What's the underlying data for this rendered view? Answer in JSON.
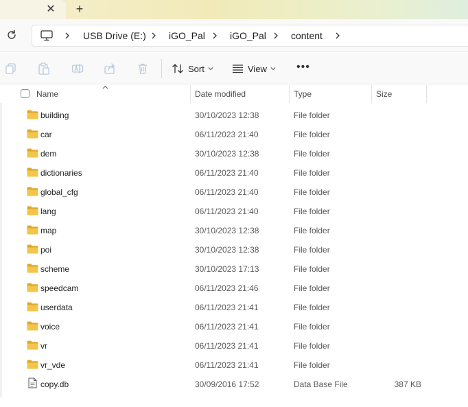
{
  "tabs": {
    "close_symbol": "✕",
    "new_tab_symbol": "+"
  },
  "address": {
    "breadcrumbs": [
      "USB Drive (E:)",
      "iGO_Pal",
      "iGO_Pal",
      "content"
    ]
  },
  "toolbar": {
    "sort_label": "Sort",
    "view_label": "View",
    "more_label": "•••"
  },
  "columns": {
    "name": "Name",
    "date_modified": "Date modified",
    "type": "Type",
    "size": "Size"
  },
  "files": [
    {
      "name": "building",
      "date": "30/10/2023 12:38",
      "type": "File folder",
      "size": "",
      "kind": "folder"
    },
    {
      "name": "car",
      "date": "06/11/2023 21:40",
      "type": "File folder",
      "size": "",
      "kind": "folder"
    },
    {
      "name": "dem",
      "date": "30/10/2023 12:38",
      "type": "File folder",
      "size": "",
      "kind": "folder"
    },
    {
      "name": "dictionaries",
      "date": "06/11/2023 21:40",
      "type": "File folder",
      "size": "",
      "kind": "folder"
    },
    {
      "name": "global_cfg",
      "date": "06/11/2023 21:40",
      "type": "File folder",
      "size": "",
      "kind": "folder"
    },
    {
      "name": "lang",
      "date": "06/11/2023 21:40",
      "type": "File folder",
      "size": "",
      "kind": "folder"
    },
    {
      "name": "map",
      "date": "30/10/2023 12:38",
      "type": "File folder",
      "size": "",
      "kind": "folder"
    },
    {
      "name": "poi",
      "date": "30/10/2023 12:38",
      "type": "File folder",
      "size": "",
      "kind": "folder"
    },
    {
      "name": "scheme",
      "date": "30/10/2023 17:13",
      "type": "File folder",
      "size": "",
      "kind": "folder"
    },
    {
      "name": "speedcam",
      "date": "06/11/2023 21:46",
      "type": "File folder",
      "size": "",
      "kind": "folder"
    },
    {
      "name": "userdata",
      "date": "06/11/2023 21:41",
      "type": "File folder",
      "size": "",
      "kind": "folder"
    },
    {
      "name": "voice",
      "date": "06/11/2023 21:41",
      "type": "File folder",
      "size": "",
      "kind": "folder"
    },
    {
      "name": "vr",
      "date": "06/11/2023 21:41",
      "type": "File folder",
      "size": "",
      "kind": "folder"
    },
    {
      "name": "vr_vde",
      "date": "06/11/2023 21:41",
      "type": "File folder",
      "size": "",
      "kind": "folder"
    },
    {
      "name": "copy.db",
      "date": "30/09/2016 17:52",
      "type": "Data Base File",
      "size": "387 KB",
      "kind": "file"
    }
  ],
  "icons": {
    "folder": "folder-icon",
    "file": "file-icon",
    "folder_color": "#f3c64b",
    "folder_dark": "#e0a82e"
  }
}
